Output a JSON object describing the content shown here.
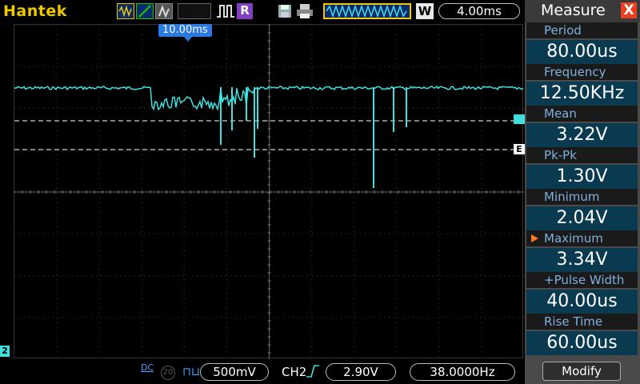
{
  "header": {
    "brand": "Hantek",
    "rec_label": "R",
    "stop_label": "W",
    "timebase": "4.00ms"
  },
  "screen": {
    "trigger_position": "10.00ms",
    "channel_marker": "2",
    "cursor_b_label": "E",
    "trace_color": "#40e0e0"
  },
  "bottom": {
    "coupling": "DC",
    "bw_limit": "20",
    "volts_div": "500mV",
    "trigger_source": "CH2",
    "trigger_level": "2.90V",
    "frequency": "38.0000Hz"
  },
  "measure": {
    "title": "Measure",
    "close_label": "X",
    "items": [
      {
        "label": "Period",
        "value": "80.00us"
      },
      {
        "label": "Frequency",
        "value": "12.50KHz"
      },
      {
        "label": "Mean",
        "value": "3.22V"
      },
      {
        "label": "Pk-Pk",
        "value": "1.30V"
      },
      {
        "label": "Minimum",
        "value": "2.04V"
      },
      {
        "label": "Maximum",
        "value": "3.34V"
      },
      {
        "label": "+Pulse Width",
        "value": "40.00us"
      },
      {
        "label": "Rise Time",
        "value": "60.00us"
      }
    ],
    "selected_index": 5,
    "modify_label": "Modify"
  },
  "icons": [
    "math-icon",
    "pass-fail-icon",
    "waveform-icon",
    "pulse-icon",
    "save-icon",
    "print-icon",
    "trigger-bar-icon",
    "close-icon",
    "edge-rising-icon"
  ]
}
